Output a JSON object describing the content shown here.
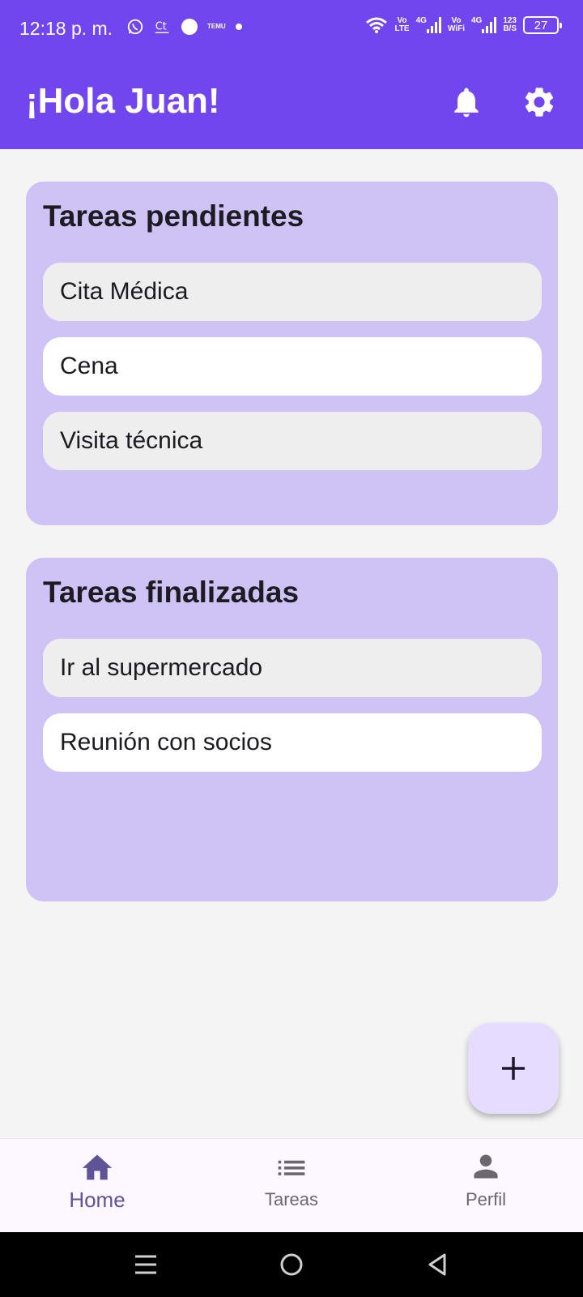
{
  "status_bar": {
    "time": "12:18 p. m.",
    "notification_icons": [
      "whatsapp-icon",
      "ct-icon",
      "dot-icon",
      "temu-icon",
      "small-dot-icon"
    ],
    "temu_label": "TEMU",
    "vo_lte": [
      "Vo",
      "LTE"
    ],
    "net_4g": "4G",
    "vo_wifi": [
      "Vo",
      "WiFi"
    ],
    "net_speed": [
      "123",
      "B/S"
    ],
    "battery": "27"
  },
  "app_bar": {
    "title": "¡Hola Juan!",
    "background": "#7246ee",
    "actions": [
      "bell-icon",
      "gear-icon"
    ]
  },
  "pending": {
    "title": "Tareas pendientes",
    "items": [
      "Cita Médica",
      "Cena",
      "Visita técnica"
    ]
  },
  "finished": {
    "title": "Tareas finalizadas",
    "items": [
      "Ir al supermercado",
      "Reunión con socios"
    ]
  },
  "fab": {
    "icon": "plus-icon"
  },
  "bottom_nav": {
    "items": [
      {
        "label": "Home",
        "icon": "home-icon",
        "active": true
      },
      {
        "label": "Tareas",
        "icon": "list-icon",
        "active": false
      },
      {
        "label": "Perfil",
        "icon": "person-icon",
        "active": false
      }
    ]
  },
  "system_nav": [
    "menu-icon",
    "home-circle-icon",
    "back-icon"
  ]
}
